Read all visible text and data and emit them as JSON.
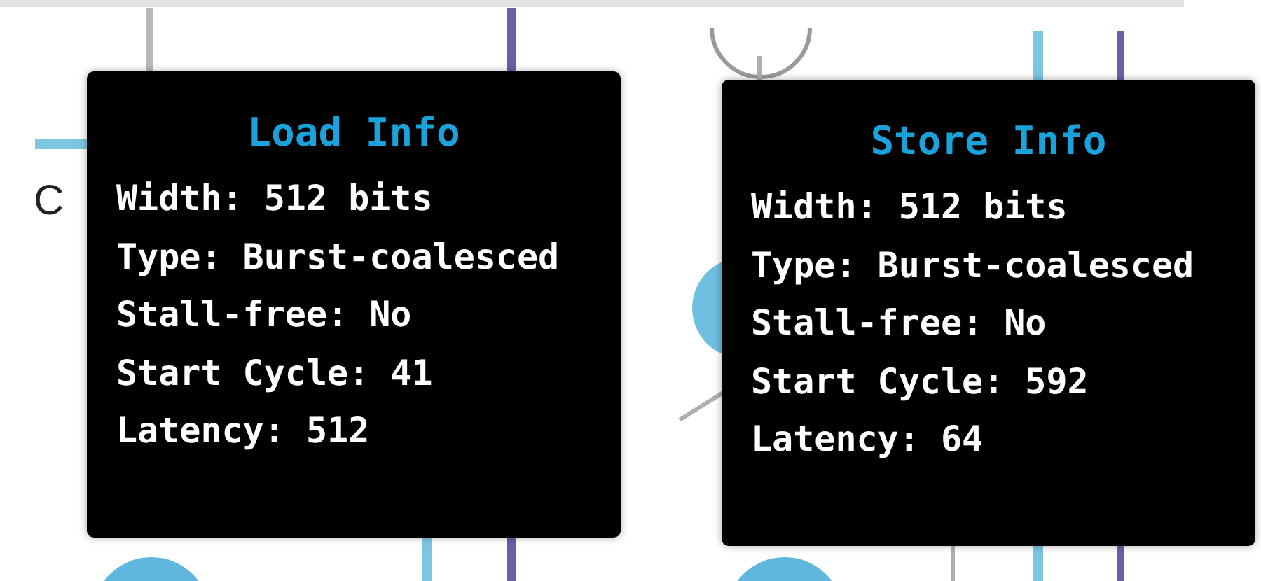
{
  "background_label": "C",
  "tooltips": [
    {
      "title": "Load Info",
      "lines": [
        "Width: 512 bits",
        "Type: Burst-coalesced",
        "Stall-free: No",
        "Start Cycle: 41",
        "Latency: 512"
      ]
    },
    {
      "title": "Store Info",
      "lines": [
        "Width: 512 bits",
        "Type: Burst-coalesced",
        "Stall-free: No",
        "Start Cycle: 592",
        "Latency: 64"
      ]
    }
  ]
}
